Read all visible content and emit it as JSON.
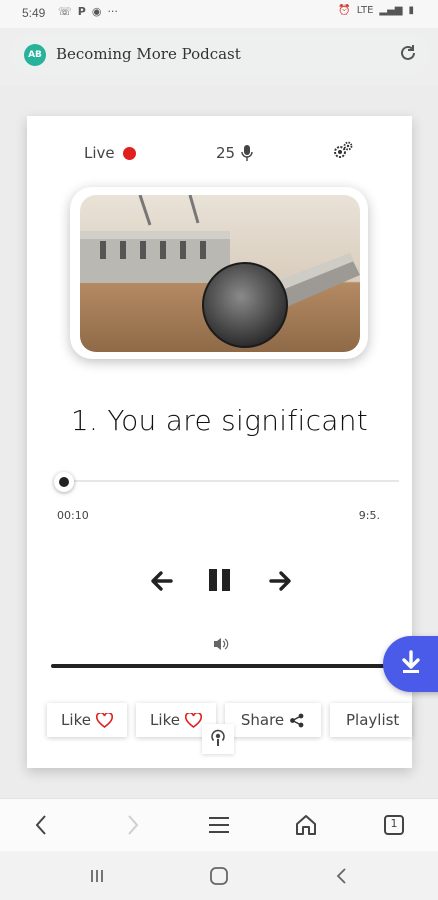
{
  "status_bar": {
    "time": "5:49",
    "left_icons": [
      "whatsapp-icon",
      "p-icon",
      "messenger-icon",
      "more-dots-icon"
    ],
    "right_icons": [
      "alarm-icon",
      "lte-icon",
      "signal-icon",
      "battery-icon"
    ],
    "lte": "LTE"
  },
  "browser": {
    "favicon_text": "AB",
    "page_title": "Becoming More Podcast"
  },
  "player": {
    "live_label": "Live",
    "listener_count": "25",
    "track_title": "1. You are significant",
    "current_time": "00:10",
    "duration": "9:5.",
    "progress_fraction": 0.0
  },
  "actions": {
    "like1": "Like",
    "like2": "Like",
    "share": "Share",
    "playlist": "Playlist"
  },
  "colors": {
    "live_dot": "#e0201f",
    "fab": "#4a5bea",
    "favicon": "#26b39a"
  },
  "browser_nav_badge": "1"
}
